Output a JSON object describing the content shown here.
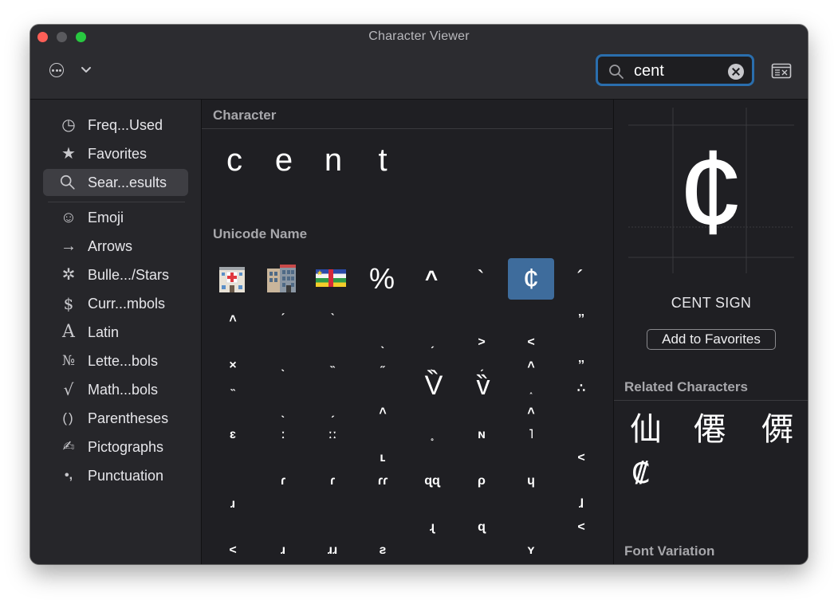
{
  "window": {
    "title": "Character Viewer"
  },
  "toolbar": {
    "search_value": "cent",
    "icons": [
      "more-actions-icon",
      "chevron-down-icon",
      "search-icon",
      "clear-icon",
      "character-palette-icon"
    ]
  },
  "sidebar": {
    "items": [
      {
        "label": "Freq...Used",
        "icon": "clock-icon",
        "glyph": "◷"
      },
      {
        "label": "Favorites",
        "icon": "star-icon",
        "glyph": "★"
      },
      {
        "label": "Sear...esults",
        "icon": "search-icon",
        "glyph": "⌕",
        "active": true
      },
      {
        "label": "Emoji",
        "icon": "smiley-icon",
        "glyph": "☺"
      },
      {
        "label": "Arrows",
        "icon": "arrow-icon",
        "glyph": "→"
      },
      {
        "label": "Bulle.../Stars",
        "icon": "asterisk-icon",
        "glyph": "✲"
      },
      {
        "label": "Curr...mbols",
        "icon": "dollar-icon",
        "glyph": "$"
      },
      {
        "label": "Latin",
        "icon": "latin-a-icon",
        "glyph": "A"
      },
      {
        "label": "Lette...bols",
        "icon": "numero-icon",
        "glyph": "№"
      },
      {
        "label": "Math...bols",
        "icon": "square-root-icon",
        "glyph": "√"
      },
      {
        "label": "Parentheses",
        "icon": "parentheses-icon",
        "glyph": "()"
      },
      {
        "label": "Pictographs",
        "icon": "pictograph-icon",
        "glyph": "✍"
      },
      {
        "label": "Punctuation",
        "icon": "punctuation-icon",
        "glyph": "•,"
      }
    ]
  },
  "main": {
    "character_section_title": "Character",
    "character_chars": [
      "c",
      "e",
      "n",
      "t"
    ],
    "unicode_section_title": "Unicode Name",
    "symbol_cells": [
      "%",
      "^",
      "`",
      "¢",
      "´"
    ],
    "glyph_rows": [
      [
        "˄",
        "ˊ",
        "ˋ",
        "",
        "",
        "",
        "",
        "ˮ"
      ],
      [
        "",
        "",
        "",
        "ˎ",
        "ˏ",
        "˃",
        "˂",
        ""
      ],
      [
        "×",
        "ˎ",
        "˵",
        "˶",
        "ˎ",
        "ˏ",
        "˄",
        "ˮ"
      ],
      [
        "˵",
        "",
        "",
        "",
        "V̏",
        "v̏",
        "˰",
        "∴"
      ],
      [
        "",
        "ˎ",
        "ˏ",
        "˄",
        "",
        "",
        "˄",
        ""
      ],
      [
        "ɛ",
        "ː",
        "ːː",
        "",
        "˳",
        "ɴ",
        "˥",
        ""
      ],
      [
        "",
        "",
        "",
        "ʟ",
        "",
        "",
        "",
        "<"
      ],
      [
        "",
        "ɾ",
        "ɾ",
        "ɾɾ",
        "ɋɋ",
        "ρ",
        "ɥ",
        ""
      ],
      [
        "ɹ",
        "",
        "",
        "",
        "",
        "",
        "",
        "ɺ"
      ],
      [
        "",
        "",
        "",
        "",
        "ɻ",
        "ɋ",
        "",
        "<"
      ],
      [
        "<",
        "ɹ",
        "ɹɹ",
        "ƨ",
        "",
        "",
        "ʏ",
        ""
      ]
    ]
  },
  "detail": {
    "preview_char": "¢",
    "char_name": "CENT SIGN",
    "add_favorites_label": "Add to Favorites",
    "related_title": "Related Characters",
    "related_chars": [
      "仙",
      "僊",
      "僲",
      "₡"
    ],
    "font_variation_title": "Font Variation"
  },
  "colors": {
    "window_bg": "#1f1f23",
    "sidebar_bg": "#26262a",
    "accent": "#2a6ead",
    "selection": "#3e6c9c"
  }
}
